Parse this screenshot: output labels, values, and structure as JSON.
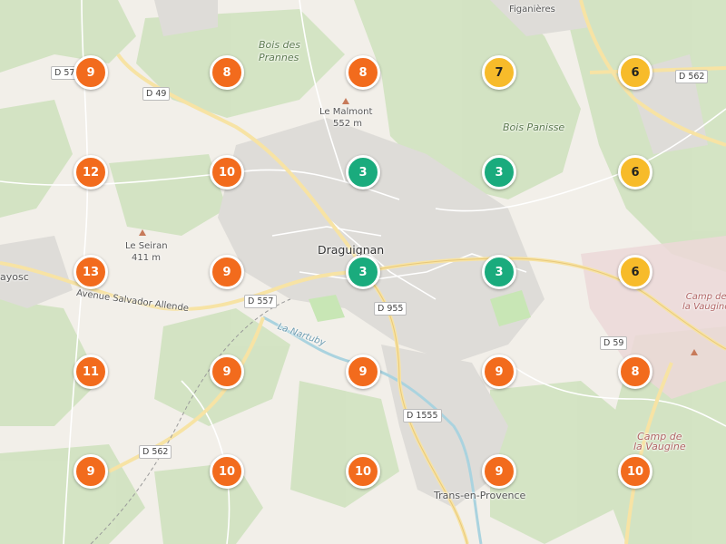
{
  "colors": {
    "orange": "#f26b1d",
    "yellow": "#f7bb2a",
    "green": "#1aab7d"
  },
  "clusters": [
    {
      "count": "9",
      "color": "orange"
    },
    {
      "count": "8",
      "color": "orange"
    },
    {
      "count": "8",
      "color": "orange"
    },
    {
      "count": "7",
      "color": "yellow"
    },
    {
      "count": "6",
      "color": "yellow"
    },
    {
      "count": "12",
      "color": "orange"
    },
    {
      "count": "10",
      "color": "orange"
    },
    {
      "count": "3",
      "color": "green"
    },
    {
      "count": "3",
      "color": "green"
    },
    {
      "count": "6",
      "color": "yellow"
    },
    {
      "count": "13",
      "color": "orange"
    },
    {
      "count": "9",
      "color": "orange"
    },
    {
      "count": "3",
      "color": "green"
    },
    {
      "count": "3",
      "color": "green"
    },
    {
      "count": "6",
      "color": "yellow"
    },
    {
      "count": "11",
      "color": "orange"
    },
    {
      "count": "9",
      "color": "orange"
    },
    {
      "count": "9",
      "color": "orange"
    },
    {
      "count": "9",
      "color": "orange"
    },
    {
      "count": "8",
      "color": "orange"
    },
    {
      "count": "9",
      "color": "orange"
    },
    {
      "count": "10",
      "color": "orange"
    },
    {
      "count": "10",
      "color": "orange"
    },
    {
      "count": "9",
      "color": "orange"
    },
    {
      "count": "10",
      "color": "orange"
    }
  ],
  "places": {
    "figanieres": "Figanières",
    "bois_des_prannes": "Bois des Prannes",
    "le_malmont": "Le Malmont",
    "le_malmont_alt": "552 m",
    "bois_panisse": "Bois Panisse",
    "draguignan": "Draguignan",
    "le_seiran": "Le Seiran",
    "le_seiran_alt": "411 m",
    "flayosc": "ayosc",
    "avenue": "Avenue Salvador Allende",
    "la_nartuby": "La Nartuby",
    "camp_vaugine_1a": "Camp de",
    "camp_vaugine_1b": "la Vaugine",
    "camp_vaugine_2a": "Camp de",
    "camp_vaugine_2b": "la Vaugine",
    "trans": "Trans-en-Provence"
  },
  "roads": {
    "d57": "D 57",
    "d49": "D 49",
    "d562_ne": "D 562",
    "d557": "D 557",
    "d955": "D 955",
    "d59": "D 59",
    "d1555": "D 1555",
    "d562_sw": "D 562"
  }
}
